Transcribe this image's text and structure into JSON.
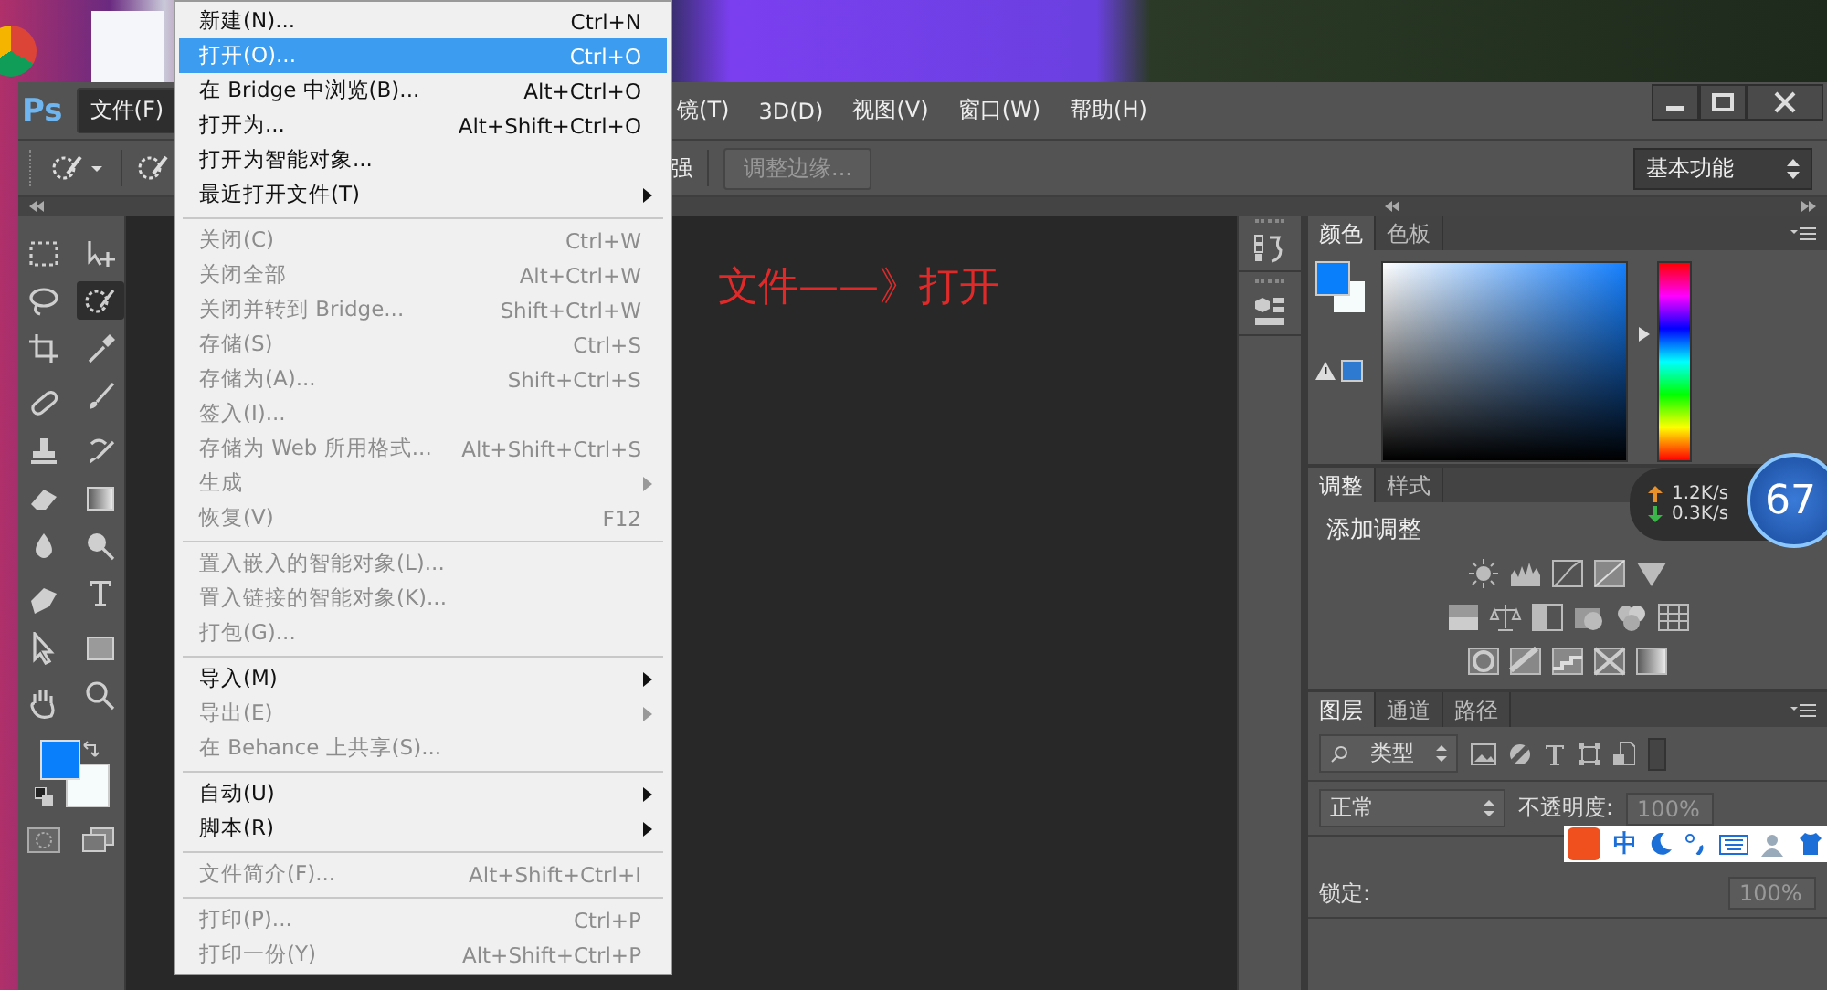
{
  "app": {
    "logo": "Ps"
  },
  "menu_bar": [
    {
      "label": "文件(F)",
      "selected": true
    },
    {
      "label": "镜(T)",
      "selected": false
    },
    {
      "label": "3D(D)",
      "selected": false
    },
    {
      "label": "视图(V)",
      "selected": false
    },
    {
      "label": "窗口(W)",
      "selected": false
    },
    {
      "label": "帮助(H)",
      "selected": false
    }
  ],
  "options_bar": {
    "cut_label": "强",
    "refine_edge_button": {
      "label": "调整边缘...",
      "disabled": true
    },
    "workspace": "基本功能"
  },
  "file_menu": [
    {
      "kind": "item",
      "label": "新建(N)...",
      "shortcut": "Ctrl+N",
      "disabled": false,
      "selected": false,
      "submenu": false
    },
    {
      "kind": "item",
      "label": "打开(O)...",
      "shortcut": "Ctrl+O",
      "disabled": false,
      "selected": true,
      "submenu": false
    },
    {
      "kind": "item",
      "label": "在 Bridge 中浏览(B)...",
      "shortcut": "Alt+Ctrl+O",
      "disabled": false,
      "selected": false,
      "submenu": false
    },
    {
      "kind": "item",
      "label": "打开为...",
      "shortcut": "Alt+Shift+Ctrl+O",
      "disabled": false,
      "selected": false,
      "submenu": false
    },
    {
      "kind": "item",
      "label": "打开为智能对象...",
      "disabled": false,
      "selected": false,
      "submenu": false
    },
    {
      "kind": "item",
      "label": "最近打开文件(T)",
      "disabled": false,
      "selected": false,
      "submenu": true
    },
    {
      "kind": "separator"
    },
    {
      "kind": "item",
      "label": "关闭(C)",
      "shortcut": "Ctrl+W",
      "disabled": true,
      "selected": false,
      "submenu": false
    },
    {
      "kind": "item",
      "label": "关闭全部",
      "shortcut": "Alt+Ctrl+W",
      "disabled": true,
      "selected": false,
      "submenu": false
    },
    {
      "kind": "item",
      "label": "关闭并转到 Bridge...",
      "shortcut": "Shift+Ctrl+W",
      "disabled": true,
      "selected": false,
      "submenu": false
    },
    {
      "kind": "item",
      "label": "存储(S)",
      "shortcut": "Ctrl+S",
      "disabled": true,
      "selected": false,
      "submenu": false
    },
    {
      "kind": "item",
      "label": "存储为(A)...",
      "shortcut": "Shift+Ctrl+S",
      "disabled": true,
      "selected": false,
      "submenu": false
    },
    {
      "kind": "item",
      "label": "签入(I)...",
      "disabled": true,
      "selected": false,
      "submenu": false
    },
    {
      "kind": "item",
      "label": "存储为 Web 所用格式...",
      "shortcut": "Alt+Shift+Ctrl+S",
      "disabled": true,
      "selected": false,
      "submenu": false
    },
    {
      "kind": "item",
      "label": "生成",
      "disabled": true,
      "selected": false,
      "submenu": true
    },
    {
      "kind": "item",
      "label": "恢复(V)",
      "shortcut": "F12",
      "disabled": true,
      "selected": false,
      "submenu": false
    },
    {
      "kind": "separator"
    },
    {
      "kind": "item",
      "label": "置入嵌入的智能对象(L)...",
      "disabled": true,
      "selected": false,
      "submenu": false
    },
    {
      "kind": "item",
      "label": "置入链接的智能对象(K)...",
      "disabled": true,
      "selected": false,
      "submenu": false
    },
    {
      "kind": "item",
      "label": "打包(G)...",
      "disabled": true,
      "selected": false,
      "submenu": false
    },
    {
      "kind": "separator"
    },
    {
      "kind": "item",
      "label": "导入(M)",
      "disabled": false,
      "selected": false,
      "submenu": true
    },
    {
      "kind": "item",
      "label": "导出(E)",
      "disabled": true,
      "selected": false,
      "submenu": true
    },
    {
      "kind": "item",
      "label": "在 Behance 上共享(S)...",
      "disabled": true,
      "selected": false,
      "submenu": false
    },
    {
      "kind": "separator"
    },
    {
      "kind": "item",
      "label": "自动(U)",
      "disabled": false,
      "selected": false,
      "submenu": true
    },
    {
      "kind": "item",
      "label": "脚本(R)",
      "disabled": false,
      "selected": false,
      "submenu": true
    },
    {
      "kind": "separator"
    },
    {
      "kind": "item",
      "label": "文件简介(F)...",
      "shortcut": "Alt+Shift+Ctrl+I",
      "disabled": true,
      "selected": false,
      "submenu": false
    },
    {
      "kind": "separator"
    },
    {
      "kind": "item",
      "label": "打印(P)...",
      "shortcut": "Ctrl+P",
      "disabled": true,
      "selected": false,
      "submenu": false
    },
    {
      "kind": "item",
      "label": "打印一份(Y)",
      "shortcut": "Alt+Shift+Ctrl+P",
      "disabled": true,
      "selected": false,
      "submenu": false
    }
  ],
  "canvas": {
    "annotation": "文件——》打开"
  },
  "tools": [
    {
      "selected": false
    },
    {
      "selected": false
    },
    {
      "selected": false
    },
    {
      "selected": true
    },
    {
      "selected": false
    },
    {
      "selected": false
    },
    {
      "selected": false
    },
    {
      "selected": false
    },
    {
      "selected": false
    },
    {
      "selected": false
    },
    {
      "selected": false
    },
    {
      "selected": false
    },
    {
      "selected": false
    },
    {
      "selected": false
    },
    {
      "selected": false
    },
    {
      "selected": false
    },
    {
      "selected": false
    },
    {
      "selected": false
    },
    {
      "selected": false
    },
    {
      "selected": false
    }
  ],
  "color_panel": {
    "tabs": [
      {
        "label": "颜色",
        "selected": true
      },
      {
        "label": "色板",
        "selected": false
      }
    ],
    "hue_slider": {
      "level": 0.63
    }
  },
  "adjustments_panel": {
    "tabs": [
      {
        "label": "调整",
        "selected": true
      },
      {
        "label": "样式",
        "selected": false
      }
    ],
    "title": "添加调整"
  },
  "layers_panel": {
    "tabs": [
      {
        "label": "图层",
        "selected": true
      },
      {
        "label": "通道",
        "selected": false
      },
      {
        "label": "路径",
        "selected": false
      }
    ],
    "filter": "类型",
    "blend_mode": "正常",
    "opacity_label": "不透明度:",
    "opacity": "100%",
    "lock_label": "锁定:",
    "fill": "100%"
  },
  "net_speed": {
    "up": "1.2K/s",
    "down": "0.3K/s",
    "badge": "67"
  },
  "ime_bar": {
    "mode": "中"
  }
}
